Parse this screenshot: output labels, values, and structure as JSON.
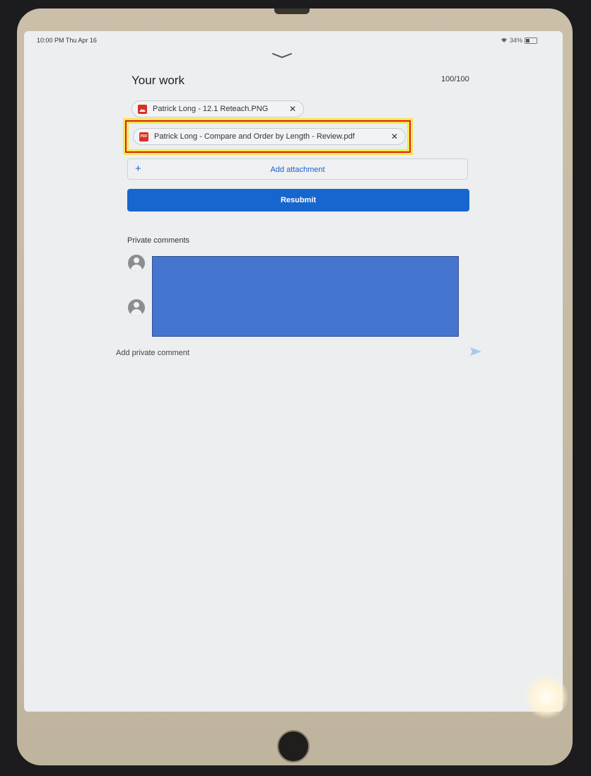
{
  "status_bar": {
    "time": "10:00 PM  Thu Apr 16",
    "battery": "34%"
  },
  "work": {
    "title": "Your work",
    "grade": "100/100",
    "attachments": [
      {
        "name": "Patrick Long - 12.1 Reteach.PNG",
        "type_icon": "image-file-icon"
      },
      {
        "name": "Patrick Long - Compare and Order by Length - Review.pdf",
        "type_icon": "pdf-file-icon",
        "icon_text": "PDF"
      }
    ],
    "add_attachment_label": "Add attachment",
    "plus_symbol": "+",
    "resubmit_label": "Resubmit",
    "remove_symbol": "✕"
  },
  "comments": {
    "label": "Private comments",
    "placeholder": "Add private comment"
  },
  "colors": {
    "accent": "#1766cf",
    "highlight_outline": "#e21b1b",
    "highlight_glow": "#f2e84f",
    "redaction": "#4675cf"
  }
}
